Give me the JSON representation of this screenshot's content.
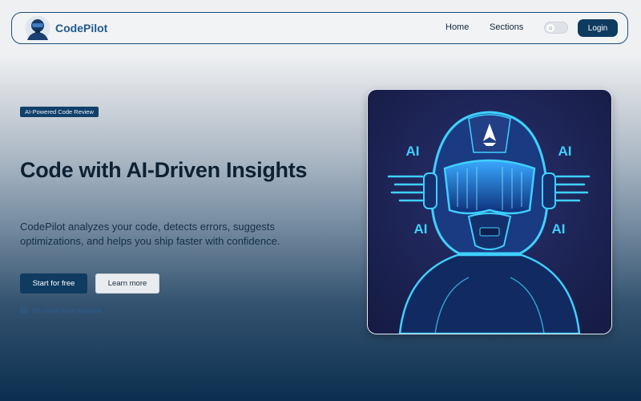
{
  "nav": {
    "brand": "CodePilot",
    "links": [
      "Home",
      "Sections"
    ],
    "login_label": "Login"
  },
  "hero": {
    "badge": "AI-Powered Code Review",
    "title": "Code with AI-Driven Insights",
    "description": "CodePilot analyzes your code, detects errors, suggests optimizations, and helps you ship faster with confidence.",
    "primary_cta": "Start for free",
    "secondary_cta": "Learn more",
    "note": "No credit card required",
    "image_labels": [
      "AI",
      "AI",
      "AI",
      "AI"
    ]
  },
  "colors": {
    "brand": "#1e5a8e",
    "primary": "#0f3b61",
    "accent_glow": "#3fd0ff",
    "image_bg": "#1a2151"
  },
  "icons": [
    "pilot-logo-icon",
    "sun-icon",
    "check-circle-icon",
    "rocket-icon"
  ]
}
